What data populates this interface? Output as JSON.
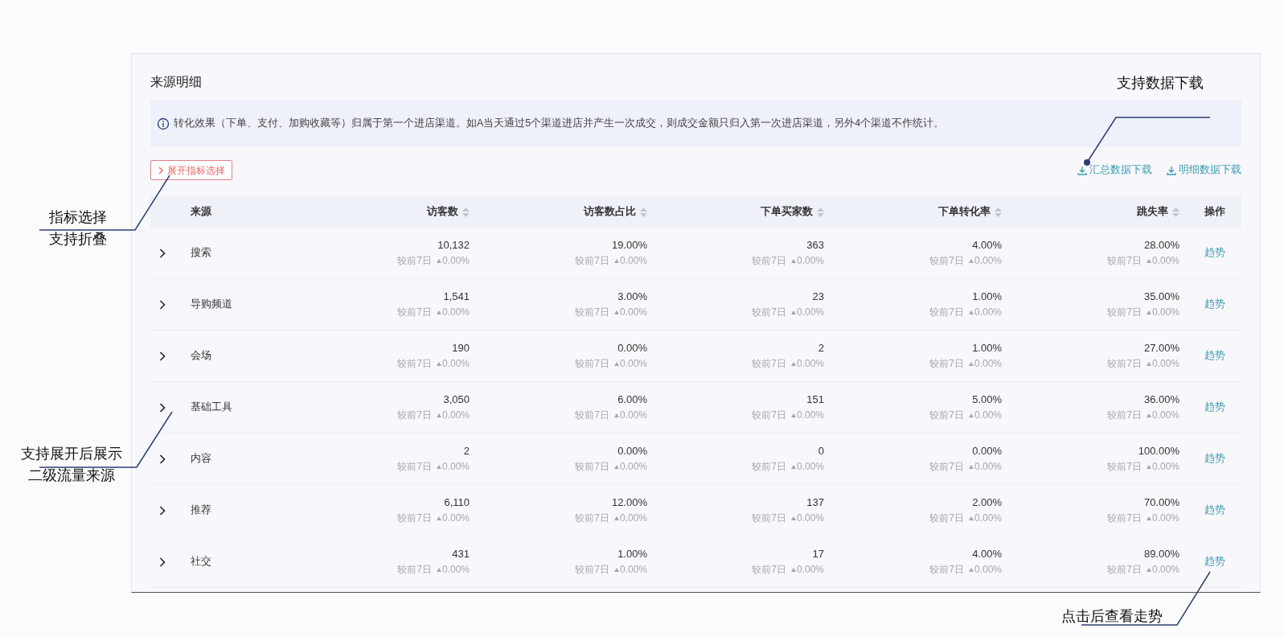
{
  "title": "来源明细",
  "notice": "转化效果（下单、支付、加购收藏等）归属于第一个进店渠道。如A当天通过5个渠道进店并产生一次成交，则成交金额只归入第一次进店渠道，另外4个渠道不作统计。",
  "expand_button": "展开指标选择",
  "downloads": [
    "汇总数据下载",
    "明细数据下载"
  ],
  "columns": [
    {
      "label": "来源",
      "sortable": false
    },
    {
      "label": "访客数",
      "sortable": true
    },
    {
      "label": "访客数占比",
      "sortable": true
    },
    {
      "label": "下单买家数",
      "sortable": true
    },
    {
      "label": "下单转化率",
      "sortable": true
    },
    {
      "label": "跳失率",
      "sortable": true
    },
    {
      "label": "操作",
      "sortable": false
    }
  ],
  "rows": [
    {
      "name": "搜索",
      "expanded": false,
      "action": "趋势",
      "metrics": [
        {
          "value": "10,132",
          "compare": "较前7日",
          "change": "0.00%"
        },
        {
          "value": "19.00%",
          "compare": "较前7日",
          "change": "0.00%"
        },
        {
          "value": "363",
          "compare": "较前7日",
          "change": "0.00%"
        },
        {
          "value": "4.00%",
          "compare": "较前7日",
          "change": "0.00%"
        },
        {
          "value": "28.00%",
          "compare": "较前7日",
          "change": "0.00%"
        }
      ]
    },
    {
      "name": "导购频道",
      "expanded": false,
      "action": "趋势",
      "metrics": [
        {
          "value": "1,541",
          "compare": "较前7日",
          "change": "0.00%"
        },
        {
          "value": "3.00%",
          "compare": "较前7日",
          "change": "0.00%"
        },
        {
          "value": "23",
          "compare": "较前7日",
          "change": "0.00%"
        },
        {
          "value": "1.00%",
          "compare": "较前7日",
          "change": "0.00%"
        },
        {
          "value": "35.00%",
          "compare": "较前7日",
          "change": "0.00%"
        }
      ]
    },
    {
      "name": "会场",
      "expanded": false,
      "action": "趋势",
      "metrics": [
        {
          "value": "190",
          "compare": "较前7日",
          "change": "0.00%"
        },
        {
          "value": "0.00%",
          "compare": "较前7日",
          "change": "0.00%"
        },
        {
          "value": "2",
          "compare": "较前7日",
          "change": "0.00%"
        },
        {
          "value": "1.00%",
          "compare": "较前7日",
          "change": "0.00%"
        },
        {
          "value": "27.00%",
          "compare": "较前7日",
          "change": "0.00%"
        }
      ]
    },
    {
      "name": "基础工具",
      "expanded": false,
      "action": "趋势",
      "metrics": [
        {
          "value": "3,050",
          "compare": "较前7日",
          "change": "0.00%"
        },
        {
          "value": "6.00%",
          "compare": "较前7日",
          "change": "0.00%"
        },
        {
          "value": "151",
          "compare": "较前7日",
          "change": "0.00%"
        },
        {
          "value": "5.00%",
          "compare": "较前7日",
          "change": "0.00%"
        },
        {
          "value": "36.00%",
          "compare": "较前7日",
          "change": "0.00%"
        }
      ]
    },
    {
      "name": "内容",
      "expanded": false,
      "action": "趋势",
      "metrics": [
        {
          "value": "2",
          "compare": "较前7日",
          "change": "0.00%"
        },
        {
          "value": "0.00%",
          "compare": "较前7日",
          "change": "0.00%"
        },
        {
          "value": "0",
          "compare": "较前7日",
          "change": "0.00%"
        },
        {
          "value": "0.00%",
          "compare": "较前7日",
          "change": "0.00%"
        },
        {
          "value": "100.00%",
          "compare": "较前7日",
          "change": "0.00%"
        }
      ]
    },
    {
      "name": "推荐",
      "expanded": false,
      "action": "趋势",
      "metrics": [
        {
          "value": "6,110",
          "compare": "较前7日",
          "change": "0.00%"
        },
        {
          "value": "12.00%",
          "compare": "较前7日",
          "change": "0.00%"
        },
        {
          "value": "137",
          "compare": "较前7日",
          "change": "0.00%"
        },
        {
          "value": "2.00%",
          "compare": "较前7日",
          "change": "0.00%"
        },
        {
          "value": "70.00%",
          "compare": "较前7日",
          "change": "0.00%"
        }
      ]
    },
    {
      "name": "社交",
      "expanded": false,
      "action": "趋势",
      "metrics": [
        {
          "value": "431",
          "compare": "较前7日",
          "change": "0.00%"
        },
        {
          "value": "1.00%",
          "compare": "较前7日",
          "change": "0.00%"
        },
        {
          "value": "17",
          "compare": "较前7日",
          "change": "0.00%"
        },
        {
          "value": "4.00%",
          "compare": "较前7日",
          "change": "0.00%"
        },
        {
          "value": "89.00%",
          "compare": "较前7日",
          "change": "0.00%"
        }
      ]
    }
  ],
  "annotations": [
    {
      "lines": [
        "指标选择",
        "支持折叠"
      ]
    },
    {
      "lines": [
        "支持展开后展示",
        "二级流量来源"
      ]
    },
    {
      "lines": [
        "支持数据下载"
      ]
    },
    {
      "lines": [
        "点击后查看走势"
      ]
    }
  ]
}
